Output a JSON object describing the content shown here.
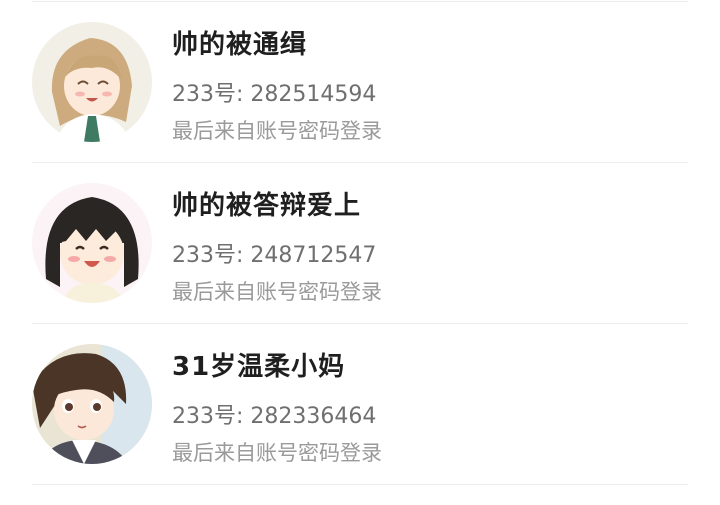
{
  "accounts": [
    {
      "name": "帅的被通缉",
      "uid": "233号: 282514594",
      "login_method": "最后来自账号密码登录",
      "avatar": "anime-girl-smiling-avatar"
    },
    {
      "name": "帅的被答辩爱上",
      "uid": "233号: 248712547",
      "login_method": "最后来自账号密码登录",
      "avatar": "anime-girl-black-hair-avatar"
    },
    {
      "name": "31岁温柔小妈",
      "uid": "233号: 282336464",
      "login_method": "最后来自账号密码登录",
      "avatar": "anime-girl-brown-hair-avatar"
    }
  ]
}
